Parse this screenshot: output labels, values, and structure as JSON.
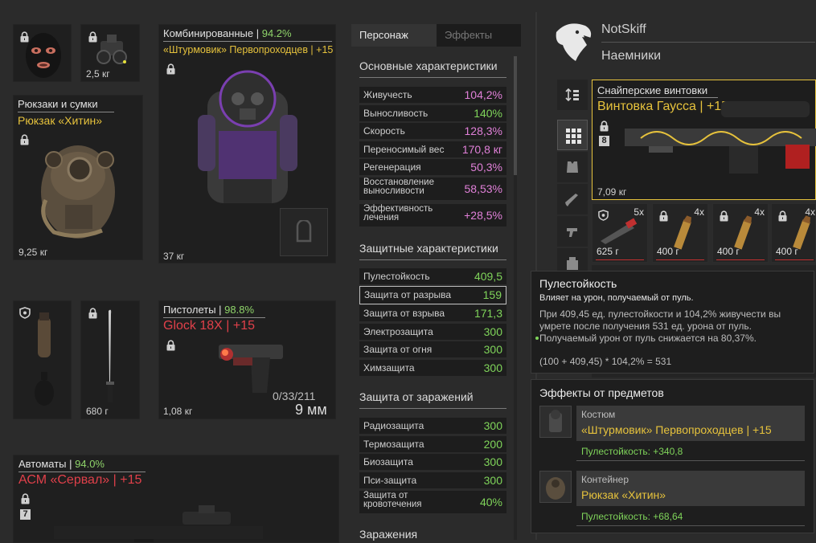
{
  "equipment": {
    "slots": {
      "mask": {
        "locked": true
      },
      "device": {
        "weight": "2,5 кг",
        "locked": true
      },
      "backpack": {
        "category": "Рюкзаки и сумки",
        "name": "Рюкзак «Хитин»",
        "weight": "9,25 кг",
        "locked": true
      },
      "armor": {
        "category": "Комбинированные",
        "condition": "94.2%",
        "name": "«Штурмовик» Первопроходцев | +15",
        "weight": "37 кг",
        "locked": true
      },
      "grenade": {
        "locked": false
      },
      "melee": {
        "weight": "680 г",
        "locked": true
      },
      "pistol": {
        "category": "Пистолеты",
        "condition": "98.8%",
        "name": "Glock 18X | +15",
        "weight": "1,08 кг",
        "ammo": "0/33/211",
        "caliber": "9 мм",
        "locked": true
      },
      "rifle": {
        "category": "Автоматы",
        "condition": "94.0%",
        "name": "АСМ «Сервал» | +15",
        "tier": "7",
        "locked": true
      }
    }
  },
  "tabs": {
    "active": "Персонаж",
    "inactive": "Эффекты"
  },
  "stats": {
    "main_title": "Основные характеристики",
    "main": [
      {
        "label": "Живучесть",
        "value": "104,2%"
      },
      {
        "label": "Выносливость",
        "value": "140%"
      },
      {
        "label": "Скорость",
        "value": "128,3%"
      },
      {
        "label": "Переносимый вес",
        "value": "170,8 кг"
      },
      {
        "label": "Регенерация",
        "value": "50,3%"
      },
      {
        "label": "Восстановление выносливости",
        "value": "58,53%"
      },
      {
        "label": "Эффективность лечения",
        "value": "+28,5%"
      }
    ],
    "protect_title": "Защитные характеристики",
    "protect": [
      {
        "label": "Пулестойкость",
        "value": "409,5"
      },
      {
        "label": "Защита от разрыва",
        "value": "159"
      },
      {
        "label": "Защита от взрыва",
        "value": "171,3"
      },
      {
        "label": "Электрозащита",
        "value": "300"
      },
      {
        "label": "Защита от огня",
        "value": "300"
      },
      {
        "label": "Химзащита",
        "value": "300"
      }
    ],
    "infect_title": "Защита от заражений",
    "infect": [
      {
        "label": "Радиозащита",
        "value": "300"
      },
      {
        "label": "Термозащита",
        "value": "200"
      },
      {
        "label": "Биозащита",
        "value": "300"
      },
      {
        "label": "Пси-защита",
        "value": "300"
      },
      {
        "label": "Защита от кровотечения",
        "value": "40%"
      }
    ],
    "last_title": "Заражения"
  },
  "player": {
    "name": "NotSkiff",
    "faction": "Наемники"
  },
  "weapon": {
    "category": "Снайперские винтовки",
    "name": "Винтовка Гаусса | +15",
    "tier": "8",
    "weight": "7,09 кг"
  },
  "ammo": [
    {
      "count": "5x",
      "weight": "625 г"
    },
    {
      "count": "4x",
      "weight": "400 г"
    },
    {
      "count": "4x",
      "weight": "400 г"
    },
    {
      "count": "4x",
      "weight": "400 г"
    }
  ],
  "tooltip": {
    "title": "Пулестойкость",
    "subtitle": "Влияет на урон, получаемый от пуль.",
    "line1": "При 409,45 ед. пулестойкости и 104,2% живучести вы",
    "line2": "умрете после получения 531 ед. урона от пуль.",
    "line3": "Получаемый урон от пуль снижается на 80,37%.",
    "formula": "(100 + 409,45) * 104,2% = 531"
  },
  "effects": {
    "title": "Эффекты от предметов",
    "items": [
      {
        "type": "Костюм",
        "name": "«Штурмовик» Первопроходцев | +15",
        "bonus": "Пулестойкость: +340,8"
      },
      {
        "type": "Контейнер",
        "name": "Рюкзак «Хитин»",
        "bonus": "Пулестойкость: +68,64"
      }
    ]
  },
  "colors": {
    "accent_yellow": "#e6c23c",
    "accent_red": "#e0404a",
    "good_green": "#7fd45a",
    "stat_pink": "#e080d8"
  }
}
